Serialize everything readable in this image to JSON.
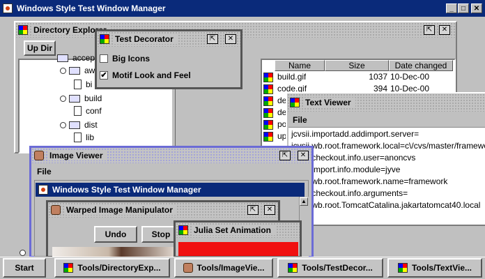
{
  "main_window": {
    "title": "Windows Style Test Window Manager",
    "controls": {
      "minimize": "_",
      "maximize": "□",
      "close": "✕"
    }
  },
  "directory_explorer": {
    "title": "Directory Explorer",
    "toolbar": {
      "up_dir": "Up Dir"
    },
    "tree": [
      "acceptance",
      "awt",
      "bi",
      "build",
      "conf",
      "dist",
      "lib"
    ],
    "table": {
      "headers": [
        "Name",
        "Size",
        "Date changed"
      ],
      "rows": [
        {
          "name": "build.gif",
          "size": "1037",
          "date": "10-Dec-00"
        },
        {
          "name": "code.gif",
          "size": "394",
          "date": "10-Dec-00"
        },
        {
          "name": "de",
          "size": "",
          "date": ""
        },
        {
          "name": "de",
          "size": "",
          "date": ""
        },
        {
          "name": "po",
          "size": "",
          "date": ""
        },
        {
          "name": "up",
          "size": "",
          "date": ""
        }
      ]
    }
  },
  "test_decorator": {
    "title": "Test Decorator",
    "options": [
      {
        "label": "Big Icons",
        "checked": false,
        "mark": ""
      },
      {
        "label": "Motif Look and Feel",
        "checked": true,
        "mark": "✔"
      }
    ]
  },
  "text_viewer": {
    "title": "Text Viewer",
    "menu": "File",
    "lines": [
      "jcvsii.importadd.addimport.server=",
      "jcvsii.wb.root.framework.local=c\\/cvs/master/framework",
      "jcvsii.checkout.info.user=anoncvs",
      "jcvsii.import.info.module=jyve",
      "jcvsii.wb.root.framework.name=framework",
      "jcvsii.checkout.info.arguments=",
      "jcvsii.wb.root.TomcatCatalina.jakartatomcat40.local"
    ]
  },
  "image_viewer": {
    "title": "Image Viewer",
    "menu": "File",
    "inner_title": "Windows Style Test Window Manager"
  },
  "warped_image": {
    "title": "Warped Image Manipulator",
    "buttons": {
      "undo": "Undo",
      "stop": "Stop"
    }
  },
  "julia": {
    "title": "Julia Set Animation"
  },
  "taskbar": {
    "start": "Start",
    "tasks": [
      "Tools/DirectoryExp...",
      "Tools/ImageVie...",
      "Tools/TestDecor...",
      "Tools/TextVie..."
    ]
  }
}
